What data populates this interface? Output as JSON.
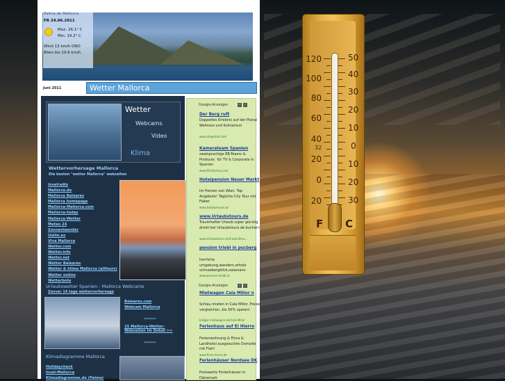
{
  "header": {
    "location": "Palma de Mallorca",
    "date": "FR 24.06.2011",
    "max": "Max: 26.1° C",
    "min": "Min: 19.2° C",
    "wind": "Wind 13 km/h ONO",
    "boen": "Böen bis 19.6 km/h",
    "month": "Juni 2011",
    "title": "Wetter Mallorca"
  },
  "menu": {
    "wetter": "Wetter",
    "webcams": "Webcams",
    "video": "Video",
    "klima": "Klima"
  },
  "forecast": {
    "title": "Wettervorhersage Mallorca",
    "subtitle": "Die besten \"wetter Mallorca\" webseiten",
    "links": [
      "Inselradio",
      "Mallorca.de",
      "Mallorca Baleares",
      "Mallorca homepage",
      "Mallorca-Mallorca.com",
      "Mallorca-today",
      "Mallorca-Wetter",
      "Meteo 24",
      "Sonnenlaender",
      "Ualim.es",
      "Viva Mallorca",
      "Wetter.com",
      "Wetter.info",
      "Wetter.net",
      "Wetter Baleares",
      "Wetter & klima Mallorca (allfours)",
      "Wetter online",
      "Wetterbote",
      "Wetter Mallorca"
    ]
  },
  "webcams": {
    "title": "Urlaubswetter Spanien - Mallorca Webcams",
    "subtitle": "Zoover 14 tage wettervorhersage",
    "link1": "Baleares.com",
    "link2": "Webcam Mallorca",
    "stars1": "*******",
    "link3": "15 Mallorca-Wetter-Webseiten im Detail >>",
    "stars2": "*******"
  },
  "klima": {
    "title": "Klimadiagramme Mallorca",
    "links": [
      "Holidaycheck",
      "Insel-Mallorca",
      "Klimadiagramme.de (Palma)"
    ]
  },
  "ads": {
    "label": "Google-Anzeigen",
    "items": [
      {
        "title": "Der Berg ruft",
        "body": "Doppeltes Erlebnis auf der Planai Wellness und Kulinarium",
        "url": "www.stegerhof.com"
      },
      {
        "title": "Kamerateam Spanien",
        "body": "zweisprachige EB-Teams & Producer, für TV & Corporate in Spanien",
        "url": "www.filmfactory.com"
      },
      {
        "title": "Hotelpension Neuer Markt",
        "body": "Im Herzen von Wien. Top Angebote! Tägliche City Tour mit Fiaker",
        "url": "www.hotelpension.at"
      },
      {
        "title": "www.Urlaubstours.de",
        "body": "Traumhafter Urlaub super günstig direkt bei Urlaubstours.de buchen!",
        "url": "www.Urlaubstours.de/Costa-Brav..."
      },
      {
        "title": "pension triebl in pucberg",
        "body": "herrliche umgebung,wandern,erholo schneebergblick,salamanv",
        "url": "www.pension-triebl.at"
      }
    ],
    "label2": "Google-Anzeigen",
    "items2": [
      {
        "title": "Mietwagen Cala Millor n",
        "body": "Schlau mieten in Cala Millor. Preise vergleichen, bis 50% sparen!",
        "url": "billiger-mietwagen.de/Cala-Millor"
      },
      {
        "title": "Ferienhaus auf El Hierro",
        "body": "Ferienwohnung & Finca & Landhotel ausgesuchte Domizile mit Flair!",
        "url": "www.finca-hierro.de"
      },
      {
        "title": "Ferienhäuser Nordsee DK",
        "body": "Preiswerte Ferienhäuser in Dänemark",
        "url": ""
      }
    ]
  },
  "thermometer": {
    "fahrenheit": [
      "120",
      "100",
      "80",
      "60",
      "40",
      "20",
      "0",
      "20"
    ],
    "celsius": [
      "50",
      "40",
      "30",
      "20",
      "10",
      "0",
      "10",
      "20",
      "30"
    ],
    "mark32": "32",
    "unit_f": "F",
    "unit_c": "C"
  }
}
